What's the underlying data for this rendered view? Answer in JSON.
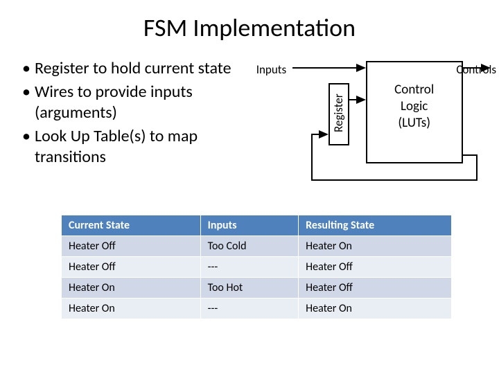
{
  "title": "FSM Implementation",
  "bullets": [
    "Register to hold current state",
    "Wires to provide inputs (arguments)",
    "Look Up Table(s) to map transitions"
  ],
  "diagram": {
    "inputs_label": "Inputs",
    "controls_label": "Controls",
    "register_label": "Register",
    "logic_line1": "Control",
    "logic_line2": "Logic",
    "logic_line3": "(LUTs)"
  },
  "table": {
    "headers": [
      "Current State",
      "Inputs",
      "Resulting State"
    ],
    "rows": [
      [
        "Heater Off",
        "Too Cold",
        "Heater On"
      ],
      [
        "Heater Off",
        "---",
        "Heater Off"
      ],
      [
        "Heater On",
        "Too Hot",
        "Heater Off"
      ],
      [
        "Heater On",
        "---",
        "Heater On"
      ]
    ]
  }
}
